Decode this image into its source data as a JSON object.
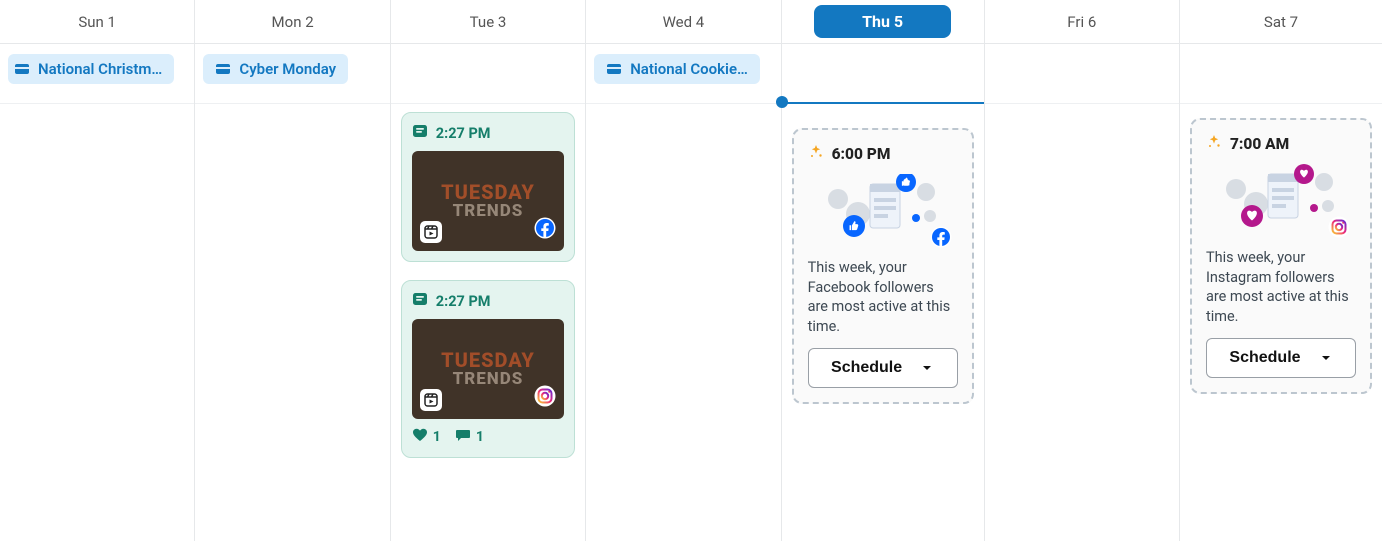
{
  "days": [
    {
      "label": "Sun 1",
      "today": false
    },
    {
      "label": "Mon 2",
      "today": false
    },
    {
      "label": "Tue 3",
      "today": false
    },
    {
      "label": "Wed 4",
      "today": false
    },
    {
      "label": "Thu 5",
      "today": true
    },
    {
      "label": "Fri 6",
      "today": false
    },
    {
      "label": "Sat 7",
      "today": false
    }
  ],
  "holidays": {
    "sun": "National Christm…",
    "mon": "Cyber Monday",
    "wed": "National Cookie…"
  },
  "posts": {
    "tue_fb": {
      "time": "2:27 PM",
      "thumb_title": "TUESDAY",
      "thumb_sub": "TRENDS",
      "network": "facebook"
    },
    "tue_ig": {
      "time": "2:27 PM",
      "thumb_title": "TUESDAY",
      "thumb_sub": "TRENDS",
      "network": "instagram",
      "likes": "1",
      "comments": "1"
    }
  },
  "suggestions": {
    "thu": {
      "time": "6:00 PM",
      "text": "This week, your Facebook followers are most active at this time.",
      "button": "Schedule",
      "network": "facebook"
    },
    "sat": {
      "time": "7:00 AM",
      "text": "This week, your Instagram followers are most active at this time.",
      "button": "Schedule",
      "network": "instagram"
    }
  },
  "colors": {
    "brand": "#1378c1",
    "fb": "#0866ff",
    "ig_pink": "#d62f7b",
    "ig_orange": "#f58529",
    "teal": "#157e6a"
  }
}
